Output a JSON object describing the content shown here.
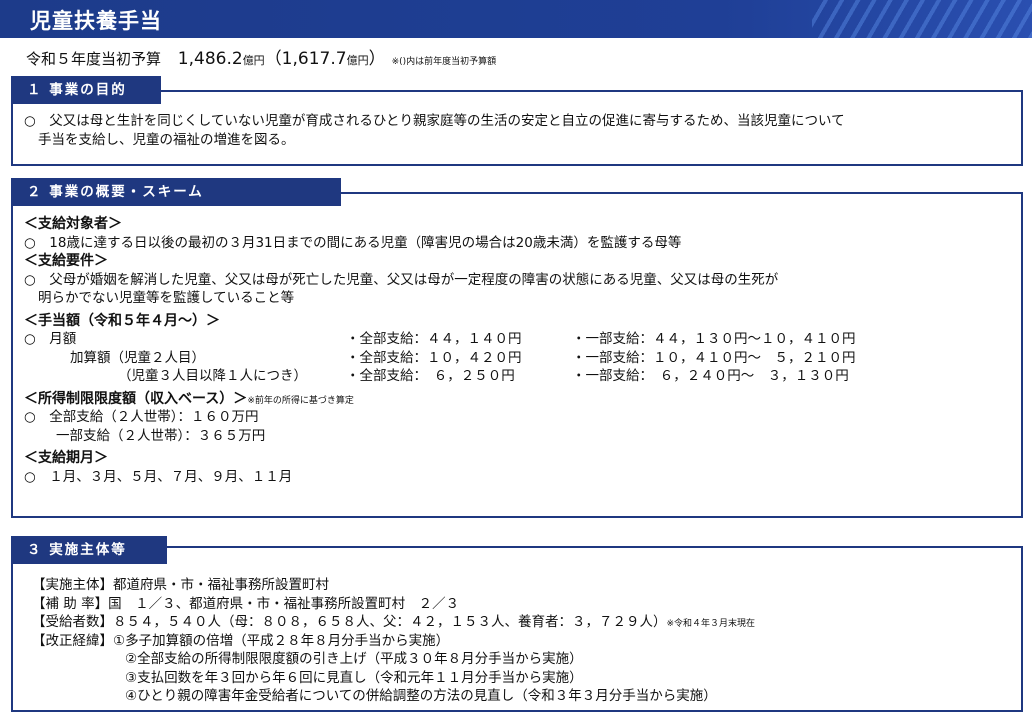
{
  "header": {
    "title": "児童扶養手当"
  },
  "budget": {
    "label": "令和５年度当初予算",
    "amount": "1,486.2",
    "unit": "億円",
    "prev_open": "（1,617.7",
    "prev_unit": "億円",
    "prev_close": "）",
    "note": "※()内は前年度当初予算額"
  },
  "section1": {
    "tag": "１ 事業の目的",
    "line1": "○　父又は母と生計を同じくしていない児童が育成されるひとり親家庭等の生活の安定と自立の促進に寄与するため、当該児童について",
    "line2": "手当を支給し、児童の福祉の増進を図る。"
  },
  "section2": {
    "tag": "２ 事業の概要・スキーム",
    "target_heading": "＜支給対象者＞",
    "target_text": "○　18歳に達する日以後の最初の３月31日までの間にある児童（障害児の場合は20歳未満）を監護する母等",
    "req_heading": "＜支給要件＞",
    "req_line1": "○　父母が婚姻を解消した児童、父又は母が死亡した児童、父又は母が一定程度の障害の状態にある児童、父又は母の生死が",
    "req_line2": "明らかでない児童等を監護していること等",
    "amount_heading": "＜手当額（令和５年４月～）＞",
    "amount_rows": [
      {
        "label": "○　月額",
        "full": "・全部支給：４４，１４０円",
        "partial": "・一部支給：４４，１３０円～１０，４１０円"
      },
      {
        "label": "加算額（児童２人目）",
        "full": "・全部支給：１０，４２０円",
        "partial": "・一部支給：１０，４１０円～　５，２１０円"
      },
      {
        "label": "（児童３人目以降１人につき）",
        "full": "・全部支給：　６，２５０円",
        "partial": "・一部支給：　６，２４０円～　３，１３０円"
      }
    ],
    "income_heading": "＜所得制限限度額（収入ベース）＞",
    "income_note": "※前年の所得に基づき算定",
    "income_line1": "○　全部支給（２人世帯）：１６０万円",
    "income_line2": "一部支給（２人世帯）：３６５万円",
    "period_heading": "＜支給期月＞",
    "period_text": "○　１月、３月、５月、７月、９月、１１月"
  },
  "section3": {
    "tag": "３ 実施主体等",
    "impl": "【実施主体】都道府県・市・福祉事務所設置町村",
    "subsidy": "【補 助 率】国　１／３、都道府県・市・福祉事務所設置町村　２／３",
    "recipients": "【受給者数】８５４，５４０人（母：８０８，６５８人、父：４２，１５３人、養育者：３，７２９人）",
    "recipients_note": "※令和４年３月末現在",
    "history_label": "【改正経緯】",
    "history": [
      "①多子加算額の倍増（平成２８年８月分手当から実施）",
      "②全部支給の所得制限限度額の引き上げ（平成３０年８月分手当から実施）",
      "③支払回数を年３回から年６回に見直し（令和元年１１月分手当から実施）",
      "④ひとり親の障害年金受給者についての併給調整の方法の見直し（令和３年３月分手当から実施）"
    ]
  }
}
